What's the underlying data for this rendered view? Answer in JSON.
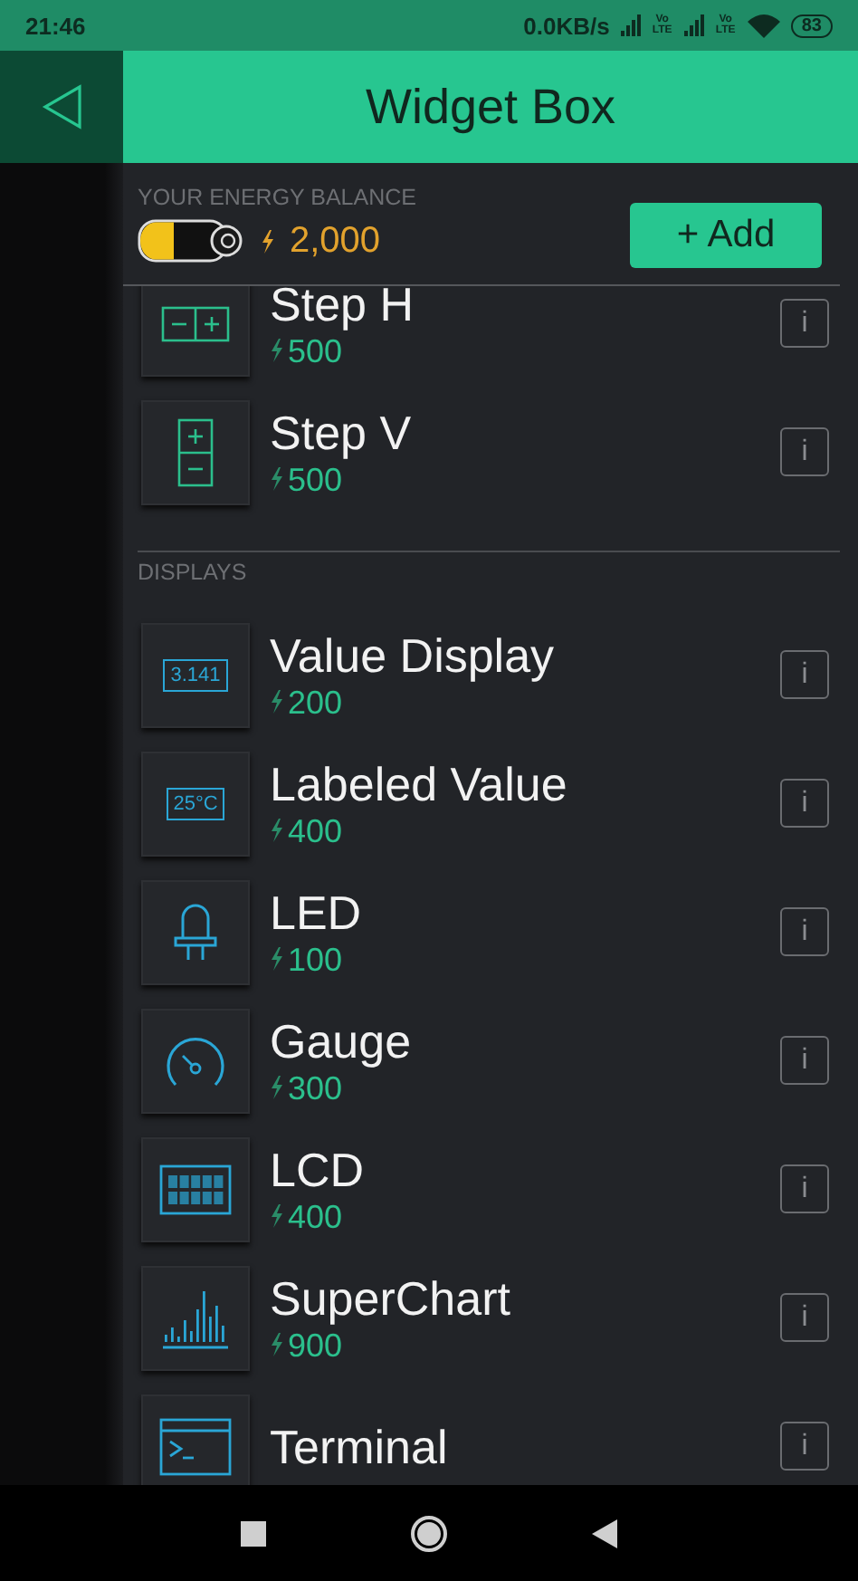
{
  "status_bar": {
    "time": "21:46",
    "speed": "0.0KB/s",
    "volte": [
      "Vo LTE",
      "Vo LTE"
    ],
    "battery": "83"
  },
  "header": {
    "title": "Widget Box"
  },
  "balance": {
    "label": "YOUR ENERGY BALANCE",
    "amount": "2,000",
    "add_button": "+ Add"
  },
  "sections": [
    {
      "items": [
        {
          "kind": "step_h",
          "name": "Step H",
          "price": "500",
          "info": "i"
        },
        {
          "kind": "step_v",
          "name": "Step V",
          "price": "500",
          "info": "i"
        }
      ]
    },
    {
      "title": "DISPLAYS",
      "items": [
        {
          "kind": "value_display",
          "name": "Value Display",
          "price": "200",
          "icon_text": "3.141",
          "info": "i"
        },
        {
          "kind": "labeled_value",
          "name": "Labeled Value",
          "price": "400",
          "icon_text": "25°C",
          "info": "i"
        },
        {
          "kind": "led",
          "name": "LED",
          "price": "100",
          "info": "i"
        },
        {
          "kind": "gauge",
          "name": "Gauge",
          "price": "300",
          "info": "i"
        },
        {
          "kind": "lcd",
          "name": "LCD",
          "price": "400",
          "info": "i"
        },
        {
          "kind": "superchart",
          "name": "SuperChart",
          "price": "900",
          "info": "i"
        },
        {
          "kind": "terminal",
          "name": "Terminal",
          "info": "i"
        }
      ]
    }
  ]
}
